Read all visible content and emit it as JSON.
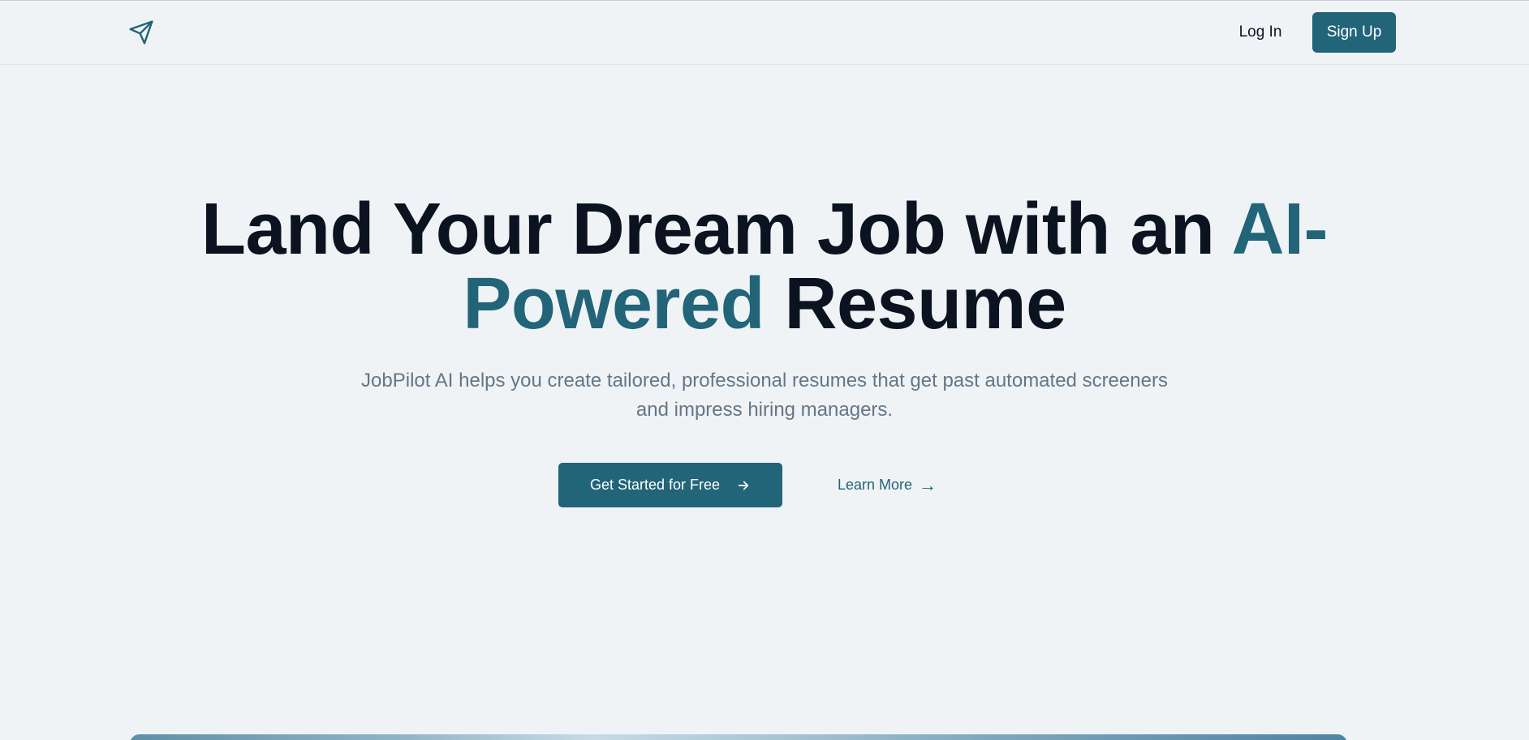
{
  "header": {
    "logo_icon": "paper-plane-icon",
    "login_label": "Log In",
    "signup_label": "Sign Up"
  },
  "hero": {
    "title_part1": "Land Your Dream Job with an ",
    "title_accent": "AI-Powered",
    "title_part2": " Resume",
    "subtitle": "JobPilot AI helps you create tailored, professional resumes that get past automated screeners and impress hiring managers.",
    "cta_primary_label": "Get Started for Free",
    "cta_primary_icon": "arrow-right-icon",
    "cta_secondary_label": "Learn More",
    "cta_secondary_icon": "→"
  },
  "colors": {
    "accent": "#226478",
    "background": "#eff3f5",
    "heading": "#0b1320",
    "muted_text": "#647687"
  }
}
